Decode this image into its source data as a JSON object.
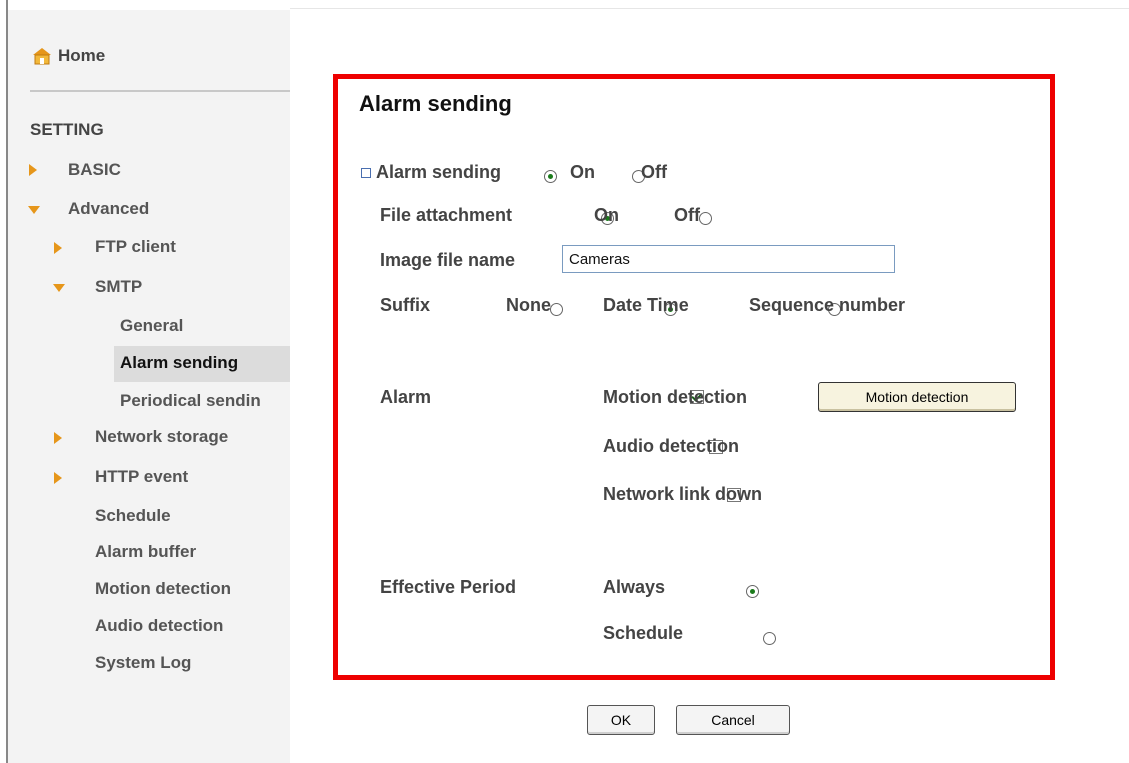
{
  "sidebar": {
    "home_label": "Home",
    "section_label": "SETTING",
    "basic_label": "BASIC",
    "advanced_label": "Advanced",
    "ftp_client_label": "FTP client",
    "smtp_label": "SMTP",
    "general_label": "General",
    "alarm_sending_label": "Alarm sending",
    "periodical_label": "Periodical sendin",
    "network_storage_label": "Network storage",
    "http_event_label": "HTTP event",
    "schedule_label": "Schedule",
    "alarm_buffer_label": "Alarm buffer",
    "motion_detection_label": "Motion detection",
    "audio_detection_label": "Audio detection",
    "system_log_label": "System Log"
  },
  "main": {
    "title": "Alarm sending",
    "alarm_sending": {
      "label": "Alarm sending",
      "on_label": "On",
      "off_label": "Off",
      "value": "On"
    },
    "file_attachment": {
      "label": "File attachment",
      "on_label": "On",
      "off_label": "Off",
      "value": "On"
    },
    "image_file_name": {
      "label": "Image file name",
      "value": "Cameras"
    },
    "suffix": {
      "label": "Suffix",
      "none_label": "None",
      "datetime_label": "Date Time",
      "sequence_label": "Sequence number",
      "value": "Date Time"
    },
    "alarm": {
      "label": "Alarm",
      "motion_label": "Motion detection",
      "motion_checked": true,
      "motion_button_label": "Motion detection",
      "audio_label": "Audio detection",
      "audio_checked": false,
      "network_label": "Network link down",
      "network_checked": false
    },
    "effective_period": {
      "label": "Effective Period",
      "always_label": "Always",
      "schedule_label": "Schedule",
      "value": "Always"
    }
  },
  "footer": {
    "ok_label": "OK",
    "cancel_label": "Cancel"
  },
  "colors": {
    "highlight_border": "#ee0000",
    "nav_arrow": "#e6961a",
    "radio_dot": "#1a7a1a"
  },
  "icons": {
    "home": "home-icon",
    "collapsed": "triangle-right-icon",
    "expanded": "triangle-down-icon"
  }
}
